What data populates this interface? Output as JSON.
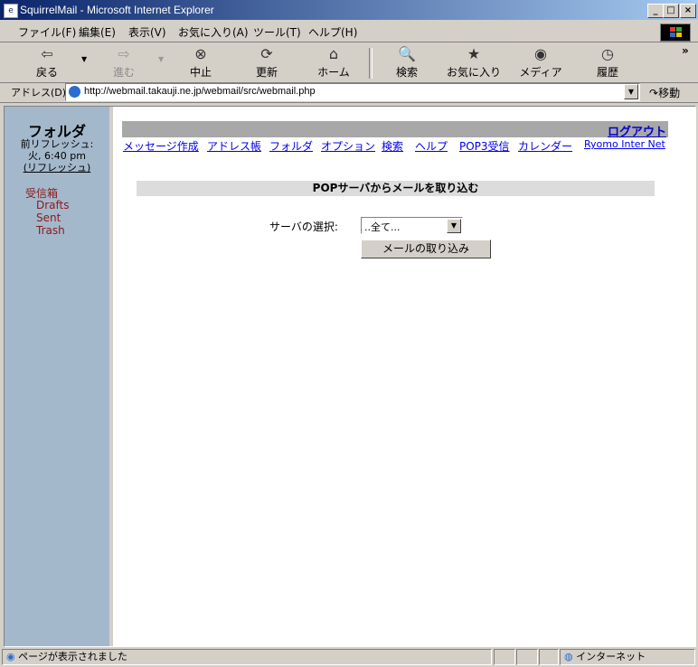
{
  "window": {
    "title": "SquirrelMail - Microsoft Internet Explorer"
  },
  "menu": [
    "ファイル(F)",
    "編集(E)",
    "表示(V)",
    "お気に入り(A)",
    "ツール(T)",
    "ヘルプ(H)"
  ],
  "toolbar": {
    "back": "戻る",
    "forward": "進む",
    "stop": "中止",
    "refresh": "更新",
    "home": "ホーム",
    "search": "検索",
    "favorites": "お気に入り",
    "media": "メディア",
    "history": "履歴",
    "chevron": "»"
  },
  "address": {
    "label": "アドレス(D)",
    "url": "http://webmail.takauji.ne.jp/webmail/src/webmail.php",
    "go": "移動"
  },
  "folders": {
    "title": "フォルダ",
    "last_refresh_label": "前リフレッシュ:",
    "last_refresh_time": "火, 6:40 pm",
    "refresh_link": "(リフレッシュ)",
    "items": [
      "受信箱",
      "Drafts",
      "Sent",
      "Trash"
    ]
  },
  "top": {
    "logout": "ログアウト",
    "nav": [
      "メッセージ作成",
      "アドレス帳",
      "フォルダ",
      "オプション",
      "検索",
      "ヘルプ",
      "POP3受信",
      "カレンダー"
    ],
    "org": "Ryomo Inter Net"
  },
  "main": {
    "heading": "POPサーバからメールを取り込む",
    "server_label": "サーバの選択:",
    "server_value": "..全て...",
    "fetch_button": "メールの取り込み"
  },
  "status": {
    "text": "ページが表示されました",
    "zone": "インターネット"
  }
}
